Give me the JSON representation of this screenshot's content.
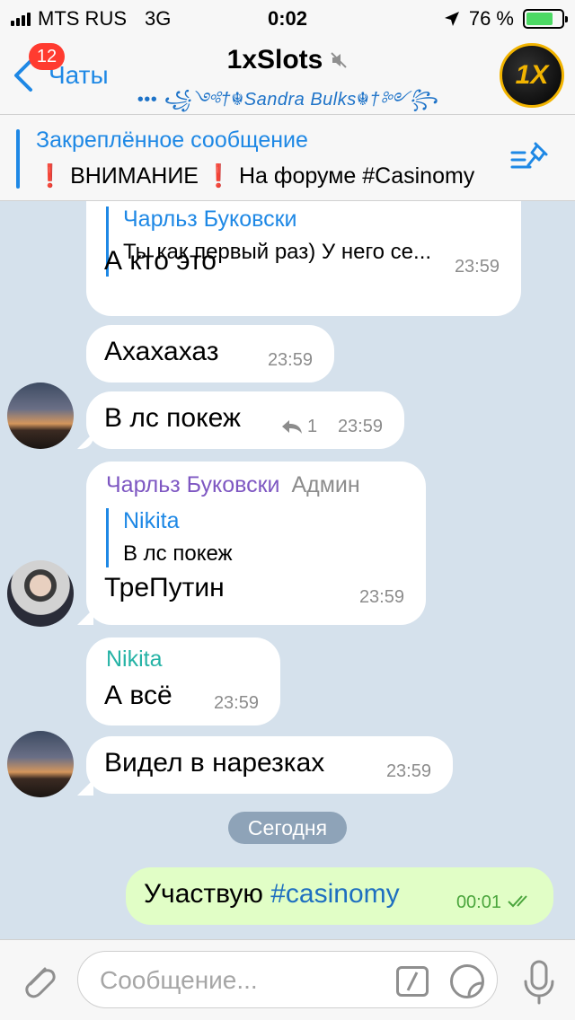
{
  "status_bar": {
    "carrier": "MTS RUS",
    "network": "3G",
    "time": "0:02",
    "battery": "76 %",
    "battery_level": 0.76
  },
  "header": {
    "back_label": "Чаты",
    "unread_badge": "12",
    "title": "1xSlots",
    "subtitle": "••• ꧁༺†☬Sandra Bulks☬†༻꧂",
    "avatar_text": "1X"
  },
  "pinned": {
    "title": "Закреплённое сообщение",
    "text": "❗ ВНИМАНИЕ ❗  На форуме #Casinomy"
  },
  "messages": [
    {
      "reply_name": "Чарльз Буковски",
      "reply_text": "Ты как первый раз) У него се...",
      "text": "А кто это",
      "time": "23:59"
    },
    {
      "text": "Ахахахаз",
      "time": "23:59"
    },
    {
      "text": "В лс покеж",
      "replies": "1",
      "time": "23:59"
    },
    {
      "sender": "Чарльз Буковски",
      "role": "Админ",
      "reply_name": "Nikita",
      "reply_text": "В лс покеж",
      "text": "ТреПутин",
      "time": "23:59"
    },
    {
      "sender": "Nikita",
      "text": "А всё",
      "time": "23:59"
    },
    {
      "text": "Видел в нарезках",
      "time": "23:59"
    },
    {
      "text_plain": "Участвую ",
      "hashtag": "#casinomy",
      "time": "00:01"
    }
  ],
  "date_separator": "Сегодня",
  "input": {
    "placeholder": "Сообщение..."
  },
  "colors": {
    "accent": "#1e88e5",
    "admin_name": "#7e57c2",
    "nikita_name": "#26b3a6",
    "outgoing_bubble": "#e1fec6",
    "badge": "#ff3b30"
  }
}
